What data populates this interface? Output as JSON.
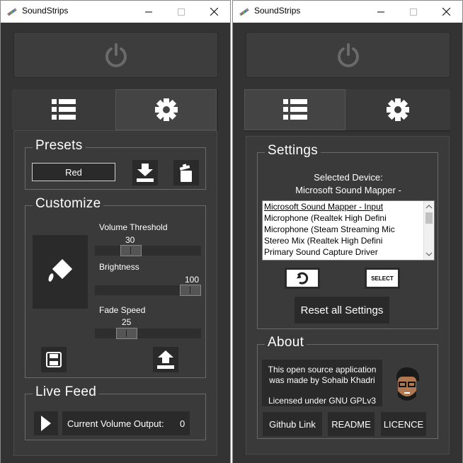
{
  "app": {
    "title": "SoundStrips"
  },
  "titlebar": {
    "minimize": "—",
    "maximize": "☐",
    "close": "✕"
  },
  "left": {
    "presets": {
      "title": "Presets",
      "current": "Red"
    },
    "customize": {
      "title": "Customize",
      "volume_threshold": {
        "label": "Volume Threshold",
        "value": "30",
        "fraction": 0.3
      },
      "brightness": {
        "label": "Brightness",
        "value": "100",
        "fraction": 1.0
      },
      "fade_speed": {
        "label": "Fade Speed",
        "value": "25",
        "fraction": 0.25
      }
    },
    "live_feed": {
      "title": "Live Feed",
      "output_label": "Current Volume Output:",
      "output_value": "0"
    }
  },
  "right": {
    "settings": {
      "title": "Settings",
      "selected_device_label": "Selected Device:",
      "selected_device_value": "Microsoft Sound Mapper -",
      "devices": [
        "Microsoft Sound Mapper - Input",
        "Microphone (Realtek High Defini",
        "Microphone (Steam Streaming Mic",
        "Stereo Mix (Realtek High Defini",
        "Primary Sound Capture Driver"
      ],
      "select_label": "SELECT",
      "reset_label": "Reset all Settings"
    },
    "about": {
      "title": "About",
      "line1": "This open source application",
      "line2": "was made by Sohaib Khadri",
      "license": "Licensed under GNU GPLv3",
      "github": "Github Link",
      "readme": "README",
      "licence": "LICENCE"
    }
  },
  "colors": {
    "background": "#333333",
    "panel": "#3a3a3a",
    "button": "#2a2a2a",
    "icon": "#ffffff",
    "power_icon": "#6a6a6a"
  }
}
